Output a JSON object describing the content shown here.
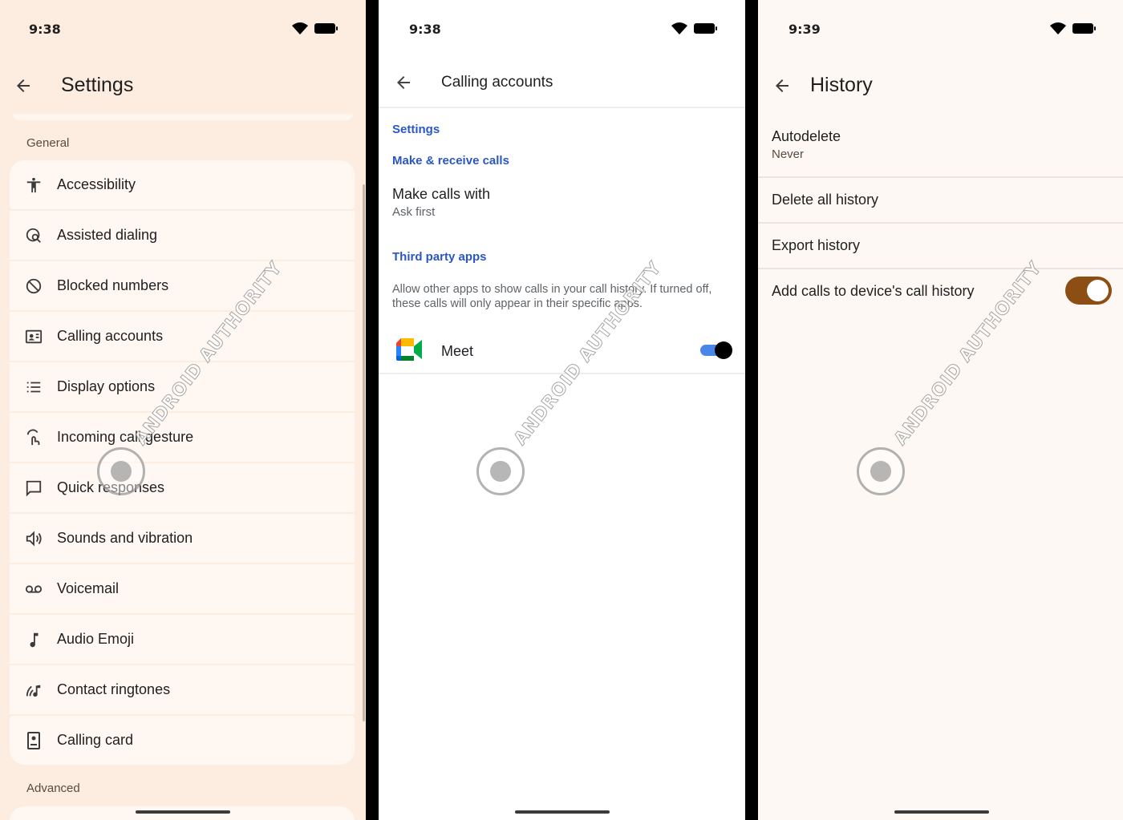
{
  "settings": {
    "status_time": "9:38",
    "title": "Settings",
    "general_label": "General",
    "advanced_label": "Advanced",
    "items": [
      {
        "label": "Accessibility",
        "icon": "accessibility-icon"
      },
      {
        "label": "Assisted dialing",
        "icon": "assisted-dialing-icon"
      },
      {
        "label": "Blocked numbers",
        "icon": "block-icon"
      },
      {
        "label": "Calling accounts",
        "icon": "account-card-icon"
      },
      {
        "label": "Display options",
        "icon": "list-icon"
      },
      {
        "label": "Incoming call gesture",
        "icon": "gesture-icon"
      },
      {
        "label": "Quick responses",
        "icon": "message-icon"
      },
      {
        "label": "Sounds and vibration",
        "icon": "speaker-icon"
      },
      {
        "label": "Voicemail",
        "icon": "voicemail-icon"
      },
      {
        "label": "Audio Emoji",
        "icon": "music-note-icon"
      },
      {
        "label": "Contact ringtones",
        "icon": "ringtone-icon"
      },
      {
        "label": "Calling card",
        "icon": "calling-card-icon"
      }
    ]
  },
  "calling_accounts": {
    "status_time": "9:38",
    "title": "Calling accounts",
    "settings_header": "Settings",
    "make_receive_header": "Make & receive calls",
    "make_calls_title": "Make calls with",
    "make_calls_value": "Ask first",
    "third_party_header": "Third party apps",
    "third_party_desc": "Allow other apps to show calls in your call history. If turned off, these calls will only appear in their specific apps.",
    "meet_label": "Meet",
    "meet_enabled": true
  },
  "history": {
    "status_time": "9:39",
    "title": "History",
    "autodelete_title": "Autodelete",
    "autodelete_value": "Never",
    "delete_all": "Delete all history",
    "export": "Export history",
    "add_calls": "Add calls to device's call history",
    "add_calls_enabled": true
  },
  "watermark": "ANDROID AUTHORITY",
  "colors": {
    "settings_bg": "#fdece0",
    "link_blue": "#2a56c6",
    "toggle_brown": "#8d4e14",
    "toggle_blue": "#4a86e8"
  }
}
